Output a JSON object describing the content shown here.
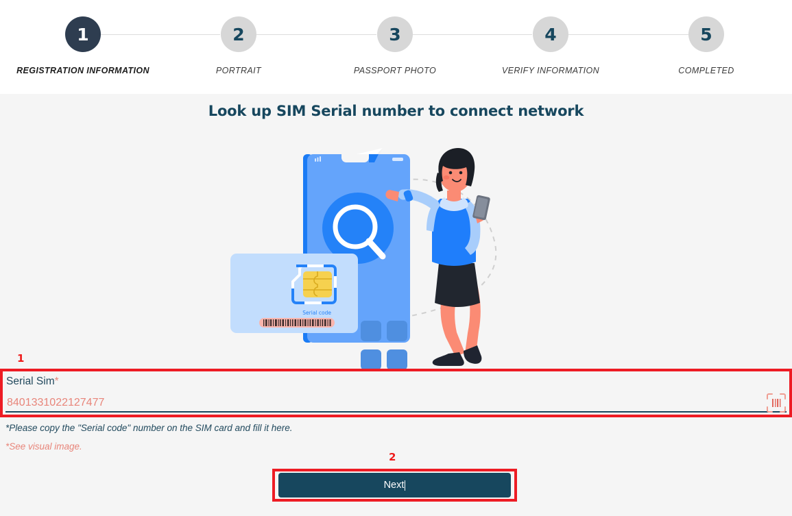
{
  "stepper": {
    "steps": [
      {
        "num": "1",
        "label": "REGISTRATION INFORMATION",
        "state": "active"
      },
      {
        "num": "2",
        "label": "PORTRAIT",
        "state": "idle"
      },
      {
        "num": "3",
        "label": "PASSPORT PHOTO",
        "state": "idle"
      },
      {
        "num": "4",
        "label": "VERIFY INFORMATION",
        "state": "idle"
      },
      {
        "num": "5",
        "label": "COMPLETED",
        "state": "idle"
      }
    ],
    "active_color": "#2e3d50",
    "idle_color": "#d7d7d7",
    "number_color": "#17475e"
  },
  "main": {
    "title": "Look up SIM Serial number to connect network"
  },
  "illustration": {
    "sim_card_label": "Serial code",
    "name": "sim-serial-lookup-illustration"
  },
  "form": {
    "serial_label": "Serial Sim",
    "required_mark": "*",
    "serial_placeholder": "8401331022127477",
    "serial_value": "",
    "barcode_icon": "barcode-scan-icon",
    "helper_primary": "*Please copy the \"Serial code\" number on the SIM card and fill it here.",
    "helper_secondary": "*See visual image.",
    "accent_salmon": "#e8857a",
    "accent_navy": "#17475e"
  },
  "next_button": {
    "label": "Next"
  },
  "annotations": {
    "badge_one": "1",
    "badge_two": "2",
    "color": "#ed1c24"
  }
}
